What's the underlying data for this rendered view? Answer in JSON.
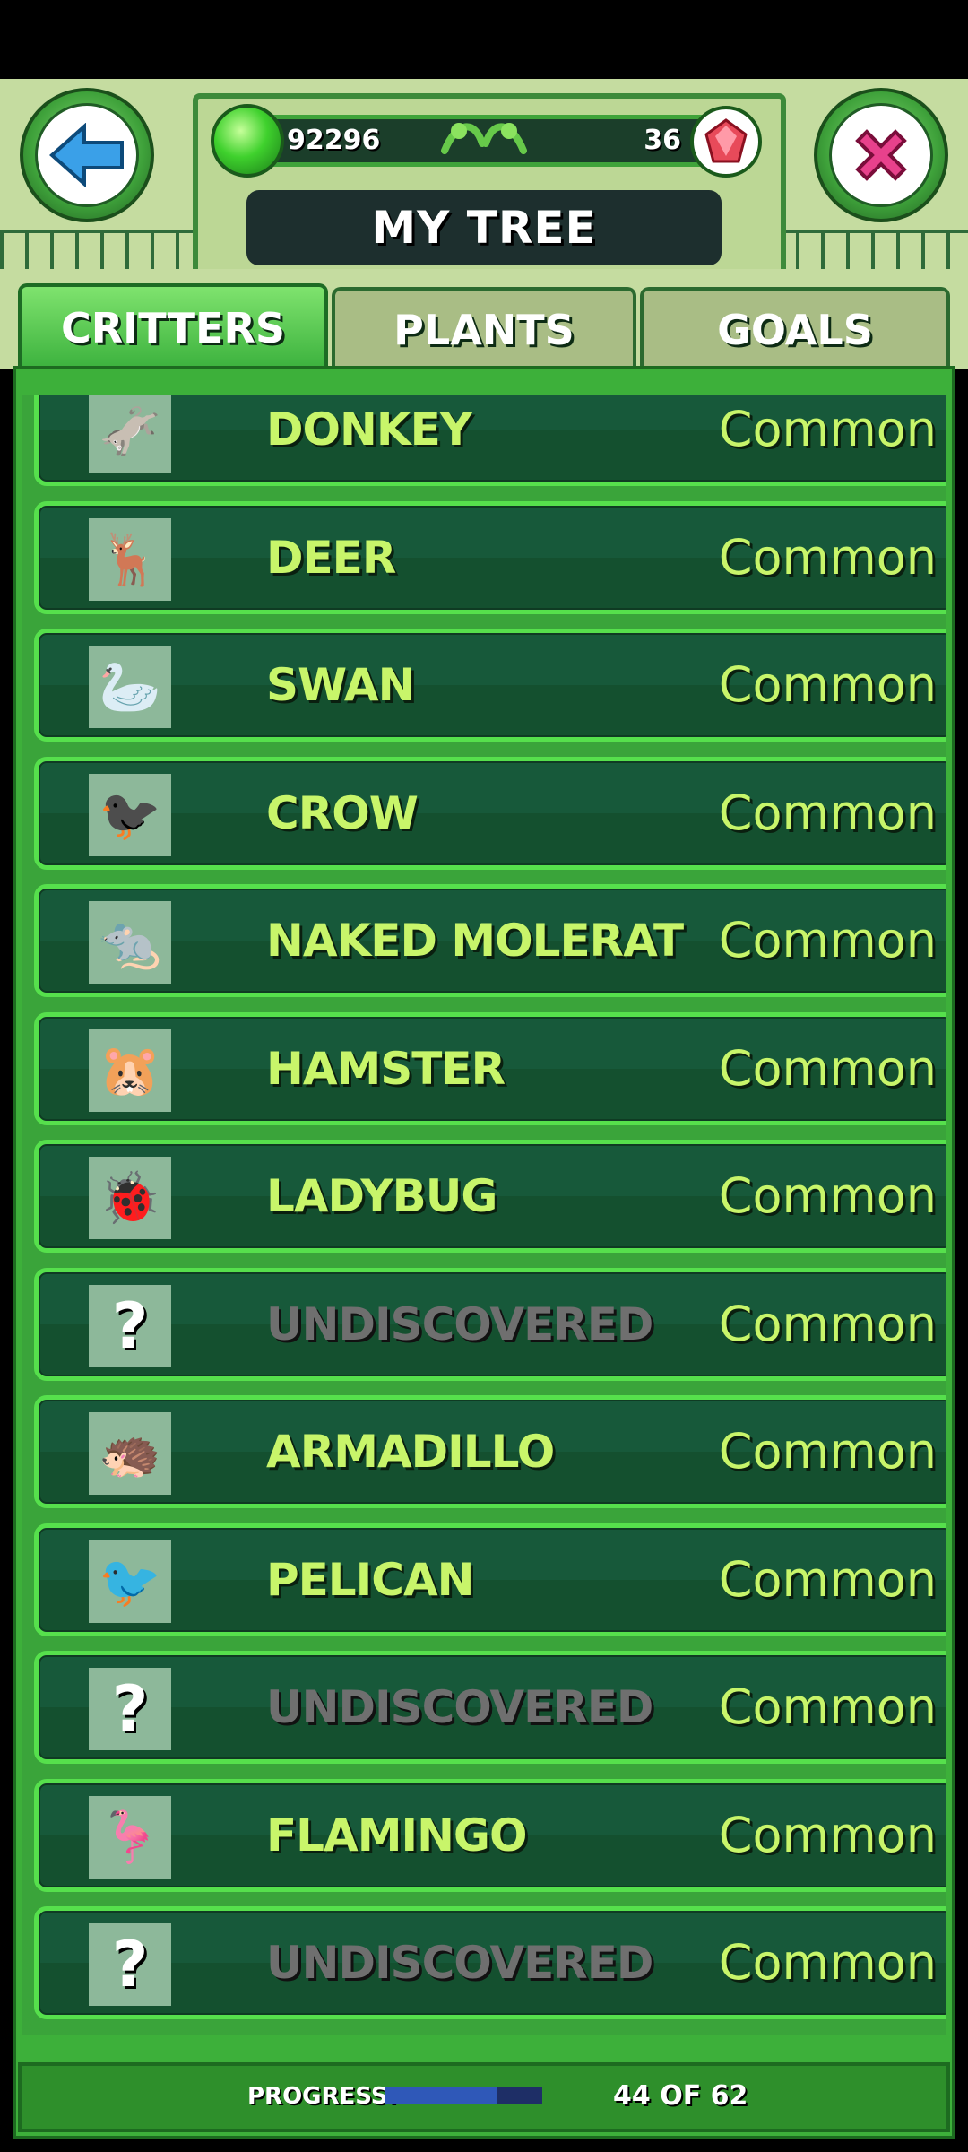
{
  "header": {
    "title": "MY TREE",
    "coins": "92296",
    "gems": "36"
  },
  "tabs": [
    {
      "label": "CRITTERS",
      "active": true
    },
    {
      "label": "PLANTS",
      "active": false
    },
    {
      "label": "GOALS",
      "active": false
    }
  ],
  "critters": [
    {
      "name": "DONKEY",
      "rarity": "Common",
      "icon": "donkey-icon",
      "emoji": "🫏",
      "discovered": true
    },
    {
      "name": "DEER",
      "rarity": "Common",
      "icon": "deer-icon",
      "emoji": "🦌",
      "discovered": true
    },
    {
      "name": "SWAN",
      "rarity": "Common",
      "icon": "swan-icon",
      "emoji": "🦢",
      "discovered": true
    },
    {
      "name": "CROW",
      "rarity": "Common",
      "icon": "crow-icon",
      "emoji": "🐦‍⬛",
      "discovered": true
    },
    {
      "name": "NAKED MOLERAT",
      "rarity": "Common",
      "icon": "molerat-icon",
      "emoji": "🐀",
      "discovered": true
    },
    {
      "name": "HAMSTER",
      "rarity": "Common",
      "icon": "hamster-icon",
      "emoji": "🐹",
      "discovered": true
    },
    {
      "name": "LADYBUG",
      "rarity": "Common",
      "icon": "ladybug-icon",
      "emoji": "🐞",
      "discovered": true
    },
    {
      "name": "UNDISCOVERED",
      "rarity": "Common",
      "icon": "question-mark-icon",
      "emoji": "?",
      "discovered": false
    },
    {
      "name": "ARMADILLO",
      "rarity": "Common",
      "icon": "armadillo-icon",
      "emoji": "🦔",
      "discovered": true
    },
    {
      "name": "PELICAN",
      "rarity": "Common",
      "icon": "pelican-icon",
      "emoji": "🐦",
      "discovered": true
    },
    {
      "name": "UNDISCOVERED",
      "rarity": "Common",
      "icon": "question-mark-icon",
      "emoji": "?",
      "discovered": false
    },
    {
      "name": "FLAMINGO",
      "rarity": "Common",
      "icon": "flamingo-icon",
      "emoji": "🦩",
      "discovered": true
    },
    {
      "name": "UNDISCOVERED",
      "rarity": "Common",
      "icon": "question-mark-icon",
      "emoji": "?",
      "discovered": false
    }
  ],
  "progress": {
    "label": "PROGRESS:",
    "text": "44 OF 62",
    "fraction": 0.71
  },
  "colors": {
    "accent_green": "#3db03a",
    "row_bg": "#17593a",
    "name_text": "#c8f56a",
    "locked_text": "#6f6f6f"
  }
}
